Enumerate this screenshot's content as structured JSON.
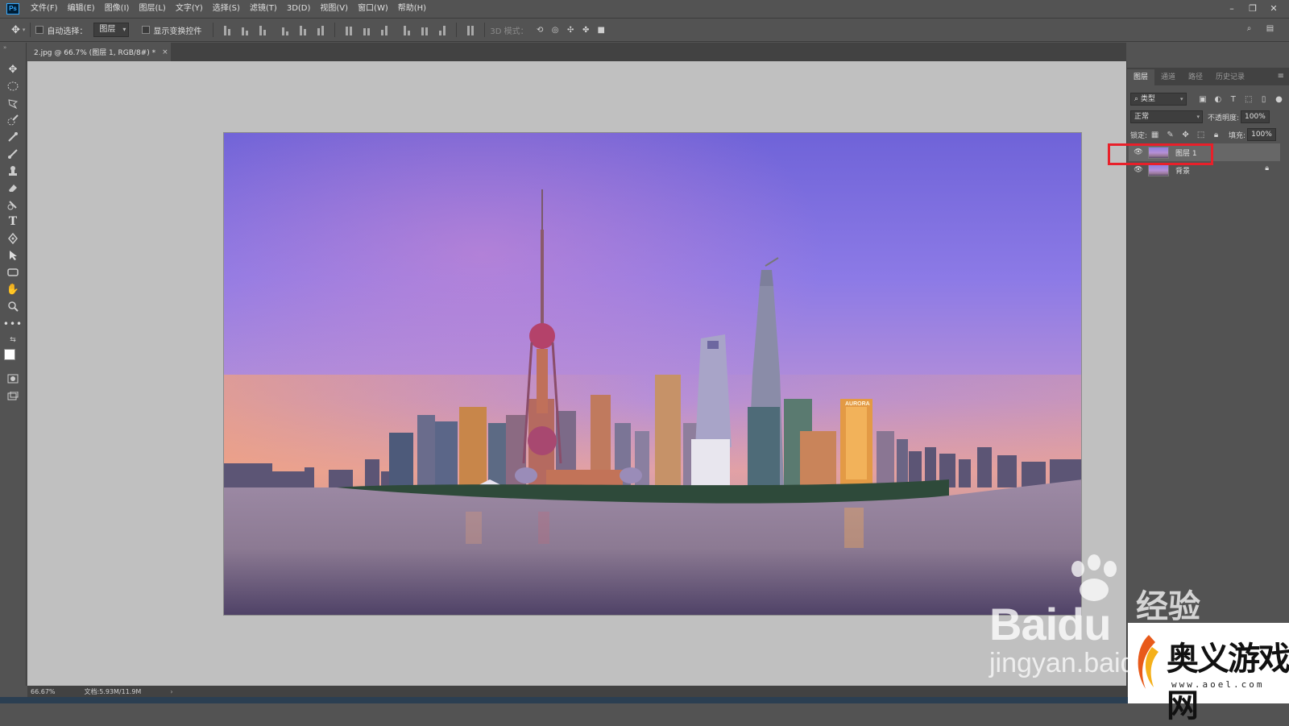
{
  "app": {
    "logo": "Ps"
  },
  "menu": [
    "文件(F)",
    "编辑(E)",
    "图像(I)",
    "图层(L)",
    "文字(Y)",
    "选择(S)",
    "滤镜(T)",
    "3D(D)",
    "视图(V)",
    "窗口(W)",
    "帮助(H)"
  ],
  "options": {
    "auto_select_label": "自动选择：",
    "auto_select_value": "图层",
    "transform_label": "显示变换控件",
    "mode_3d_label": "3D 模式："
  },
  "document_tab": {
    "title": "2.jpg @ 66.7% (图层 1, RGB/8#) *",
    "close": "×"
  },
  "status": {
    "zoom": "66.67%",
    "doc_size": "文档:5.93M/11.9M",
    "arrow": "›"
  },
  "panel": {
    "tabs": [
      "图层",
      "通道",
      "路径",
      "历史记录"
    ],
    "filter_kind": "类型",
    "blend_mode": "正常",
    "opacity_label": "不透明度:",
    "opacity_value": "100%",
    "lock_label": "锁定:",
    "fill_label": "填充:",
    "fill_value": "100%",
    "layers": [
      {
        "name": "图层 1",
        "selected": true,
        "locked": false
      },
      {
        "name": "背景",
        "selected": false,
        "locked": true
      }
    ]
  },
  "watermarks": {
    "baidu": "Baidu",
    "jingyan": "经验",
    "jingyan_url": "jingyan.baidu",
    "site_name": "奥义游戏网",
    "site_url": "www.aoel.com"
  },
  "colors": {
    "highlight": "#e8202a",
    "ui_bg": "#535353",
    "canvas_bg": "#c0c0c0"
  },
  "document_image": {
    "sign_text": "AURORA"
  }
}
